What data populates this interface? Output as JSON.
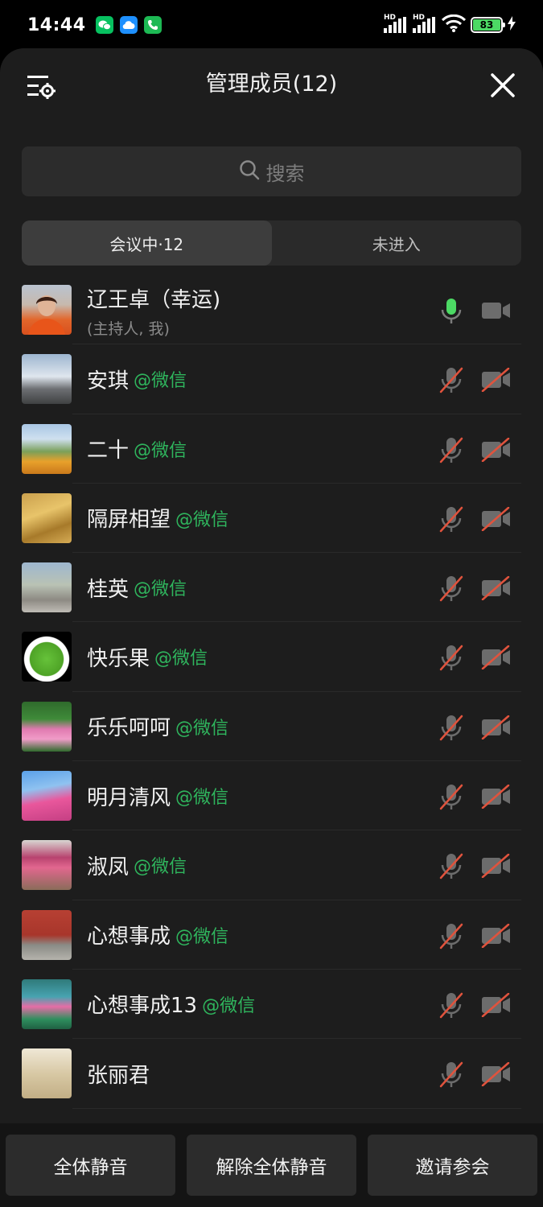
{
  "status": {
    "time": "14:44",
    "battery": "83",
    "signal_label_1": "HD",
    "signal_label_2": "HD"
  },
  "header": {
    "title": "管理成员(12)"
  },
  "search": {
    "placeholder": "搜索"
  },
  "tabs": [
    {
      "label": "会议中·12",
      "active": true
    },
    {
      "label": "未进入",
      "active": false
    }
  ],
  "host": {
    "name": "辽王卓（幸运)",
    "sub": "(主持人, 我)"
  },
  "members": [
    {
      "name": "安琪",
      "tag": "@微信"
    },
    {
      "name": "二十",
      "tag": "@微信"
    },
    {
      "name": "隔屏相望",
      "tag": "@微信"
    },
    {
      "name": "桂英",
      "tag": "@微信"
    },
    {
      "name": "快乐果",
      "tag": "@微信"
    },
    {
      "name": "乐乐呵呵",
      "tag": "@微信"
    },
    {
      "name": "明月清风",
      "tag": "@微信"
    },
    {
      "name": "淑凤",
      "tag": "@微信"
    },
    {
      "name": "心想事成",
      "tag": "@微信"
    },
    {
      "name": "心想事成13",
      "tag": "@微信"
    },
    {
      "name": "张丽君",
      "tag": ""
    }
  ],
  "bottom": {
    "mute_all": "全体静音",
    "unmute_all": "解除全体静音",
    "invite": "邀请参会"
  },
  "colors": {
    "accent_green": "#2fb55d",
    "mic_on": "#4cd964",
    "muted_slash": "#e0533d"
  }
}
